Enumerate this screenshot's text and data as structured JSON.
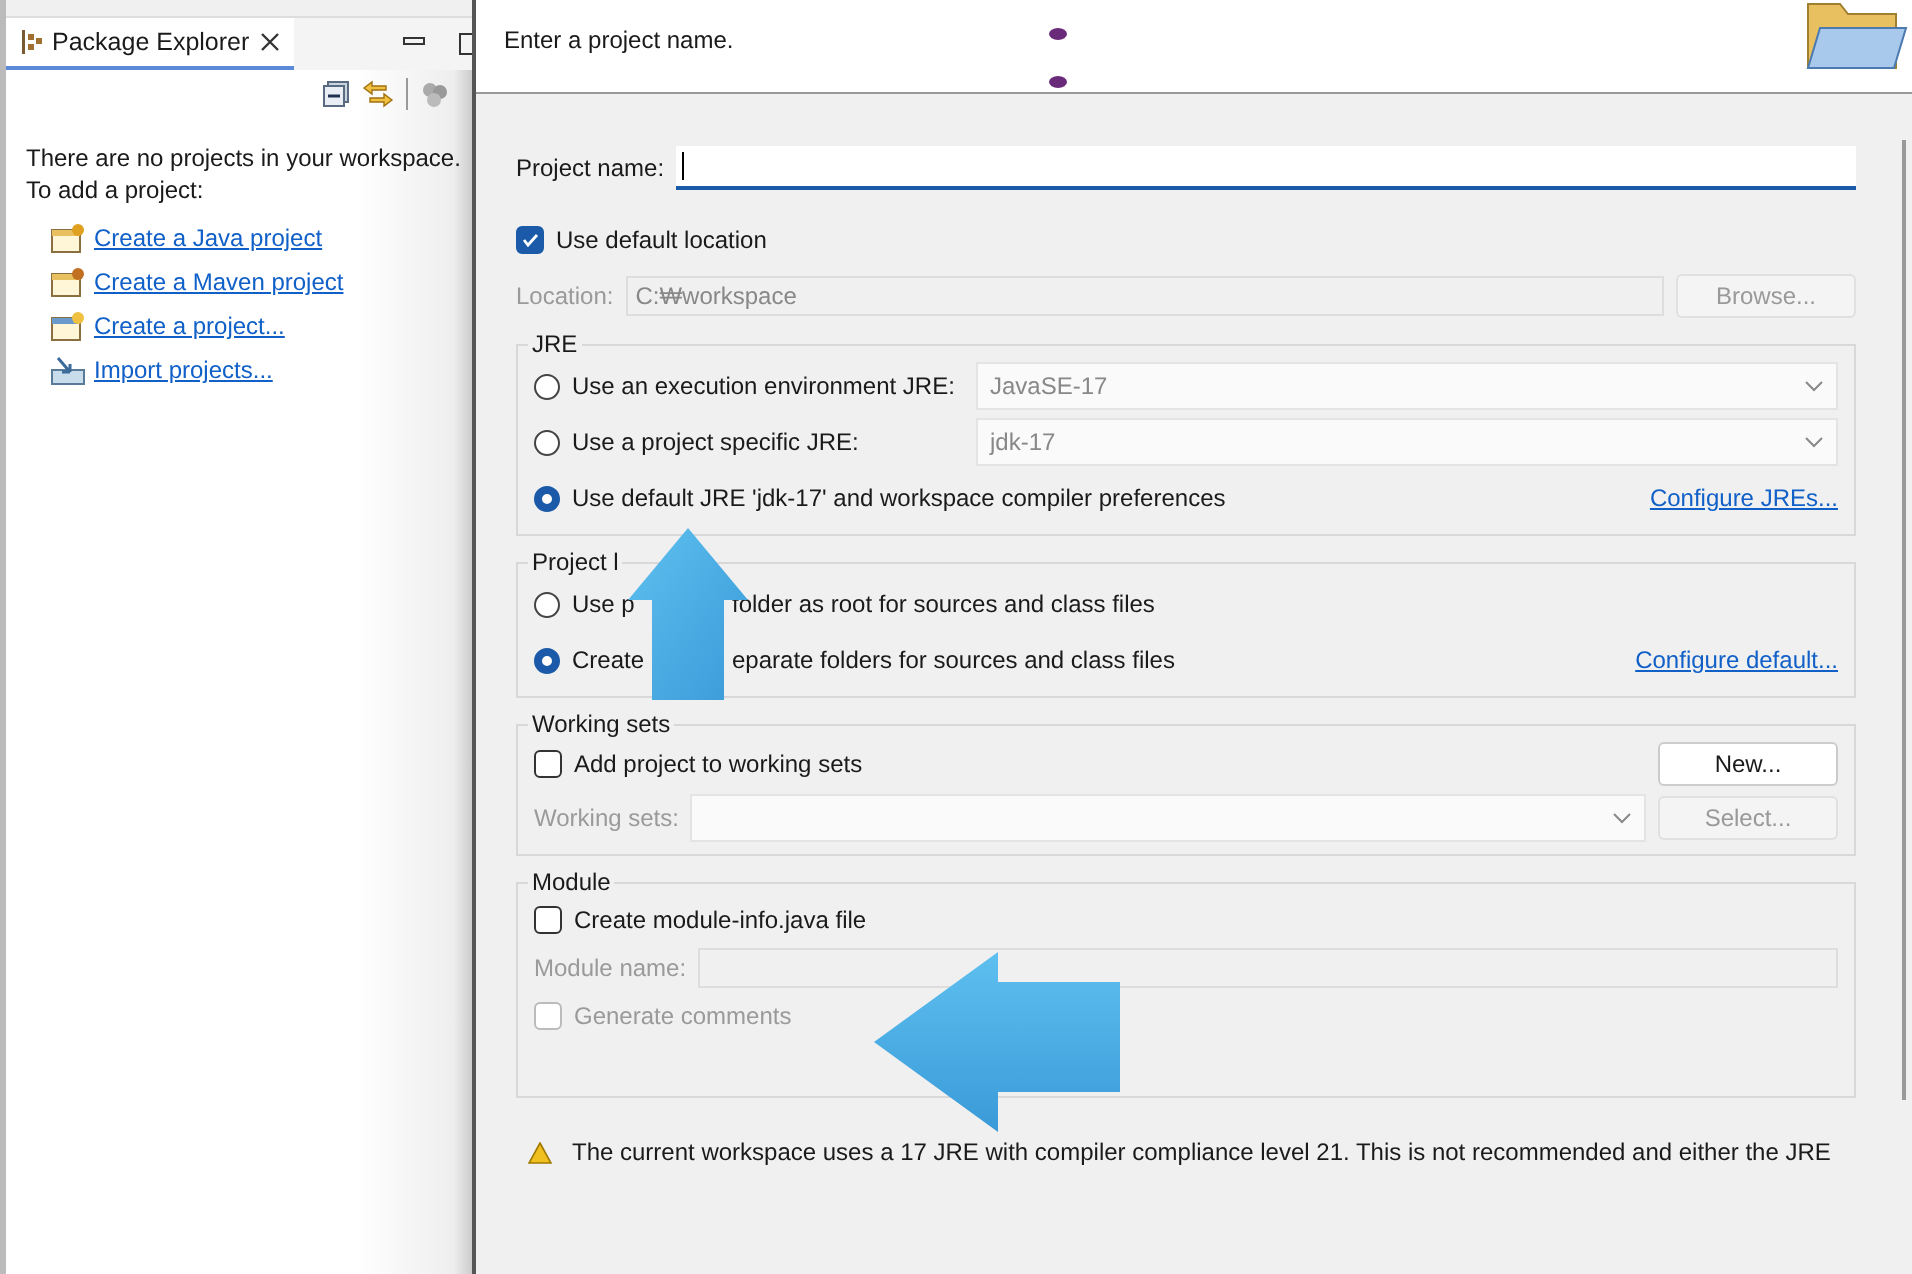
{
  "explorer": {
    "tab": {
      "label": "Package Explorer",
      "selected": true
    },
    "message": [
      "There are no projects in your workspace.",
      "To add a project:"
    ],
    "links": [
      {
        "label": "Create a Java project",
        "kind": "java"
      },
      {
        "label": "Create a Maven project",
        "kind": "maven"
      },
      {
        "label": "Create a project...",
        "kind": "generic"
      },
      {
        "label": "Import projects...",
        "kind": "import"
      }
    ]
  },
  "dialog": {
    "description": "Enter a project name.",
    "project_name": {
      "label": "Project name:"
    },
    "use_default_location": {
      "label": "Use default location",
      "checked": true
    },
    "location": {
      "label": "Location:",
      "value": "C:₩workspace",
      "disabled": true
    },
    "browse_button": {
      "label": "Browse...",
      "disabled": true
    },
    "jre": {
      "legend": "JRE",
      "options": [
        {
          "label": "Use an execution environment JRE:",
          "selected": false,
          "combo": "JavaSE-17"
        },
        {
          "label": "Use a project specific JRE:",
          "selected": false,
          "combo": "jdk-17"
        },
        {
          "label": "Use default JRE 'jdk-17' and workspace compiler preferences",
          "selected": true
        }
      ],
      "link": "Configure JREs..."
    },
    "project_layout": {
      "legend": "Project l",
      "options": [
        {
          "label_parts": [
            "Use p",
            "folder as root for sources and class files"
          ],
          "selected": false
        },
        {
          "label_parts": [
            "Create",
            "eparate folders for sources and class files"
          ],
          "selected": true
        }
      ],
      "link": "Configure default..."
    },
    "working_sets": {
      "legend": "Working sets",
      "checkbox": {
        "label": "Add project to working sets",
        "checked": false
      },
      "new_button": "New...",
      "field_label": "Working sets:",
      "select_button": "Select...",
      "disabled": true
    },
    "module": {
      "legend": "Module",
      "create": {
        "label": "Create module-info.java file",
        "checked": false
      },
      "field_label": "Module name:",
      "generate": {
        "label": "Generate comments",
        "checked": false
      },
      "disabled": true
    },
    "warning": "The current workspace uses a 17 JRE with compiler compliance level 21. This is not recommended and either the JRE"
  }
}
